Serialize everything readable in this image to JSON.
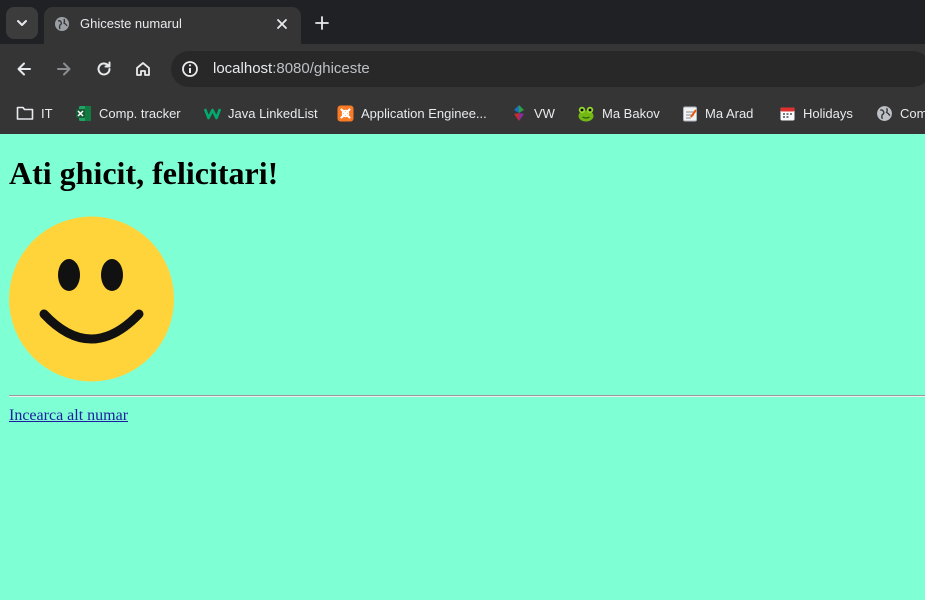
{
  "browser": {
    "tab": {
      "title": "Ghiceste numarul"
    },
    "address": {
      "host": "localhost",
      "path": ":8080/ghiceste"
    },
    "bookmarks": [
      {
        "label": "IT",
        "icon": "folder-icon"
      },
      {
        "label": "Comp. tracker",
        "icon": "excel-icon"
      },
      {
        "label": "Java LinkedList",
        "icon": "w-logo-icon"
      },
      {
        "label": "Application Enginee...",
        "icon": "xampp-icon"
      },
      {
        "label": "VW",
        "icon": "diamond-logo-icon"
      },
      {
        "label": "Ma Bakov",
        "icon": "frog-icon"
      },
      {
        "label": "Ma Arad",
        "icon": "notepad-icon"
      },
      {
        "label": "Holidays",
        "icon": "calendar-icon"
      },
      {
        "label": "Com",
        "icon": "globe-icon"
      }
    ]
  },
  "page": {
    "heading": "Ati ghicit, felicitari!",
    "smiley_icon": "smiley-face-icon",
    "link": "Incearca alt numar",
    "colors": {
      "background": "#7fffd4",
      "smiley": "#ffd43b",
      "link": "#1e1e9e"
    }
  }
}
